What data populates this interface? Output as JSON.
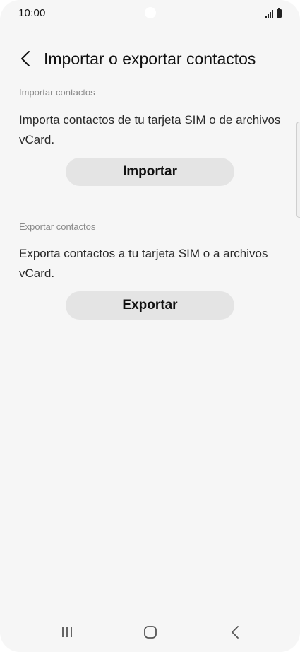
{
  "status_bar": {
    "time": "10:00",
    "icons": [
      "signal-icon",
      "battery-icon"
    ]
  },
  "header": {
    "back_icon": "chevron-left-icon",
    "title": "Importar o exportar contactos"
  },
  "import_section": {
    "label": "Importar contactos",
    "description": "Importa contactos de tu tarjeta SIM o de archivos vCard.",
    "button_label": "Importar"
  },
  "export_section": {
    "label": "Exportar contactos",
    "description": "Exporta contactos a tu tarjeta SIM o a archivos vCard.",
    "button_label": "Exportar"
  },
  "nav_bar": {
    "icons": [
      "recent-apps-icon",
      "home-icon",
      "back-icon"
    ]
  },
  "colors": {
    "background": "#f6f6f6",
    "button_bg": "#e4e4e4",
    "text_primary": "#111111",
    "text_secondary": "#8a8a8a"
  }
}
